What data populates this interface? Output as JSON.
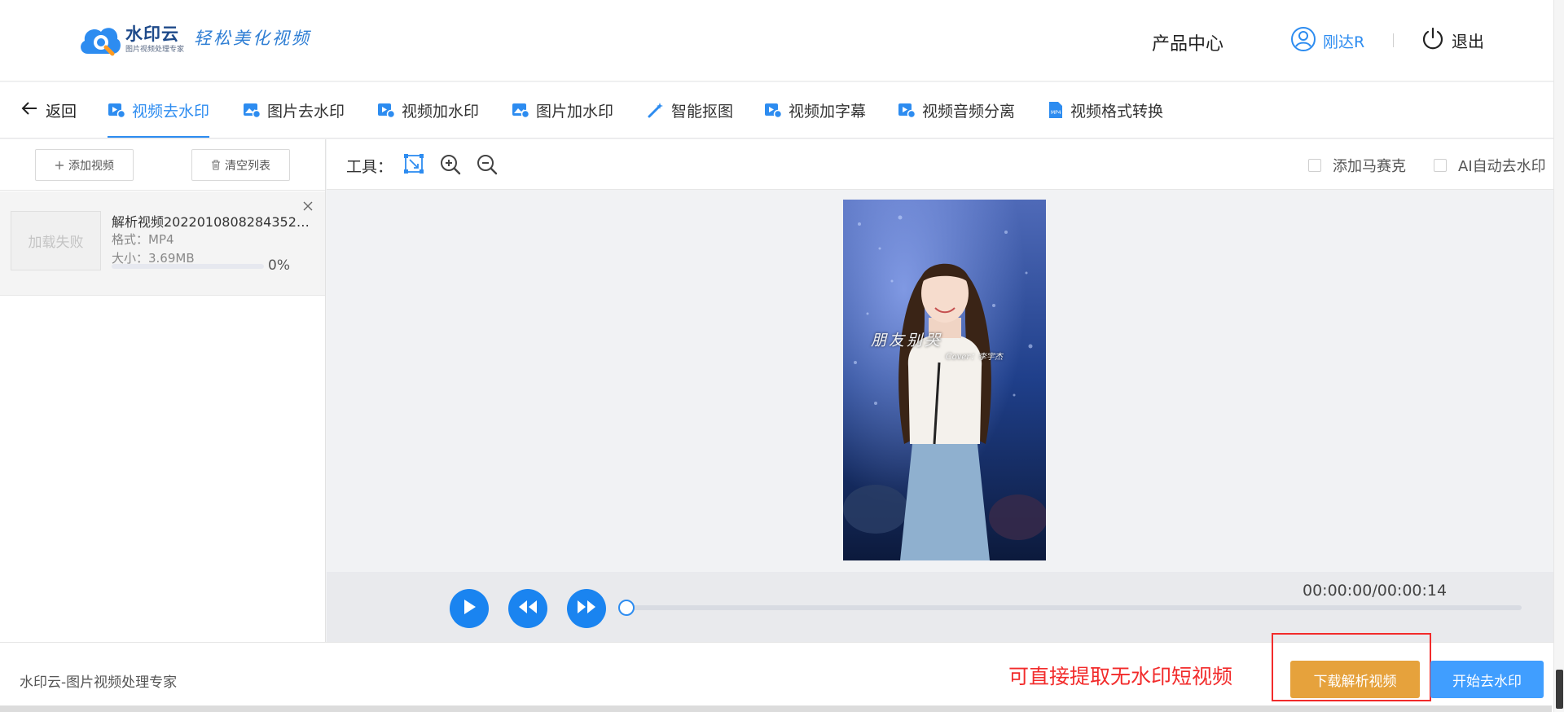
{
  "header": {
    "logo_name": "水印云",
    "logo_sub": "图片视频处理专家",
    "slogan": "轻松美化视频",
    "product_center": "产品中心",
    "user_name": "刚达R",
    "logout": "退出"
  },
  "nav": {
    "back": "返回",
    "tabs": [
      {
        "label": "视频去水印",
        "icon": "video-remove-icon"
      },
      {
        "label": "图片去水印",
        "icon": "image-remove-icon"
      },
      {
        "label": "视频加水印",
        "icon": "video-add-icon"
      },
      {
        "label": "图片加水印",
        "icon": "image-add-icon"
      },
      {
        "label": "智能抠图",
        "icon": "magic-wand-icon"
      },
      {
        "label": "视频加字幕",
        "icon": "subtitle-icon"
      },
      {
        "label": "视频音频分离",
        "icon": "audio-split-icon"
      },
      {
        "label": "视频格式转换",
        "icon": "mp4-file-icon"
      }
    ],
    "active_index": 0
  },
  "sidebar": {
    "add_video": "添加视频",
    "clear_list": "清空列表",
    "file": {
      "thumb_text": "加载失败",
      "name": "解析视频20220108082843523...",
      "format": "格式：MP4",
      "size": "大小：3.69MB",
      "progress": 0,
      "percent": "0%"
    }
  },
  "toolbar": {
    "label": "工具：",
    "icons": [
      "select-box-icon",
      "zoom-in-icon",
      "zoom-out-icon"
    ],
    "option_mosaic": "添加马赛克",
    "option_ai": "AI自动去水印"
  },
  "preview": {
    "watermark_main": "朋友别哭",
    "watermark_credit": "Cover：李宇杰"
  },
  "player": {
    "time": "00:00:00/00:00:14",
    "position": 0
  },
  "footer": {
    "brand": "水印云-图片视频处理专家",
    "callout": "可直接提取无水印短视频",
    "download_button": "下载解析视频",
    "start_button": "开始去水印"
  },
  "colors": {
    "primary": "#2d8cf0",
    "download": "#e6a23c",
    "start": "#409eff",
    "callout": "#f22b2b"
  }
}
